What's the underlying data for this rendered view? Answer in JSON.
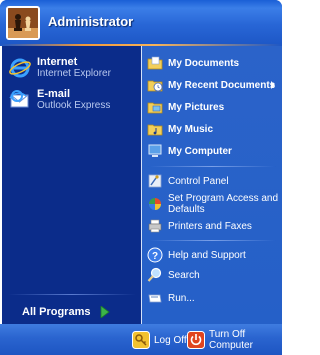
{
  "header": {
    "username": "Administrator"
  },
  "pinned": [
    {
      "title": "Internet",
      "subtitle": "Internet Explorer",
      "icon": "internet-explorer-icon"
    },
    {
      "title": "E-mail",
      "subtitle": "Outlook Express",
      "icon": "outlook-express-icon"
    }
  ],
  "all_programs": {
    "label": "All Programs"
  },
  "right": [
    {
      "label": "My Documents",
      "icon": "my-documents-icon"
    },
    {
      "label": "My Recent Documents",
      "icon": "my-recent-documents-icon",
      "submenu": true
    },
    {
      "label": "My Pictures",
      "icon": "my-pictures-icon"
    },
    {
      "label": "My Music",
      "icon": "my-music-icon"
    },
    {
      "label": "My Computer",
      "icon": "my-computer-icon"
    },
    {
      "label": "Control Panel",
      "icon": "control-panel-icon"
    },
    {
      "label_line1": "Set Program Access and",
      "label_line2": "Defaults",
      "icon": "set-program-access-icon"
    },
    {
      "label": "Printers and Faxes",
      "icon": "printers-faxes-icon"
    },
    {
      "label": "Help and Support",
      "icon": "help-icon"
    },
    {
      "label": "Search",
      "icon": "search-icon"
    },
    {
      "label": "Run...",
      "icon": "run-icon"
    }
  ],
  "footer": {
    "logoff_label": "Log Off",
    "turnoff_label": "Turn Off Computer"
  },
  "colors": {
    "left_panel": "#0b2c8a",
    "right_panel": "#2560c8",
    "accent_orange": "#f39a3a"
  }
}
